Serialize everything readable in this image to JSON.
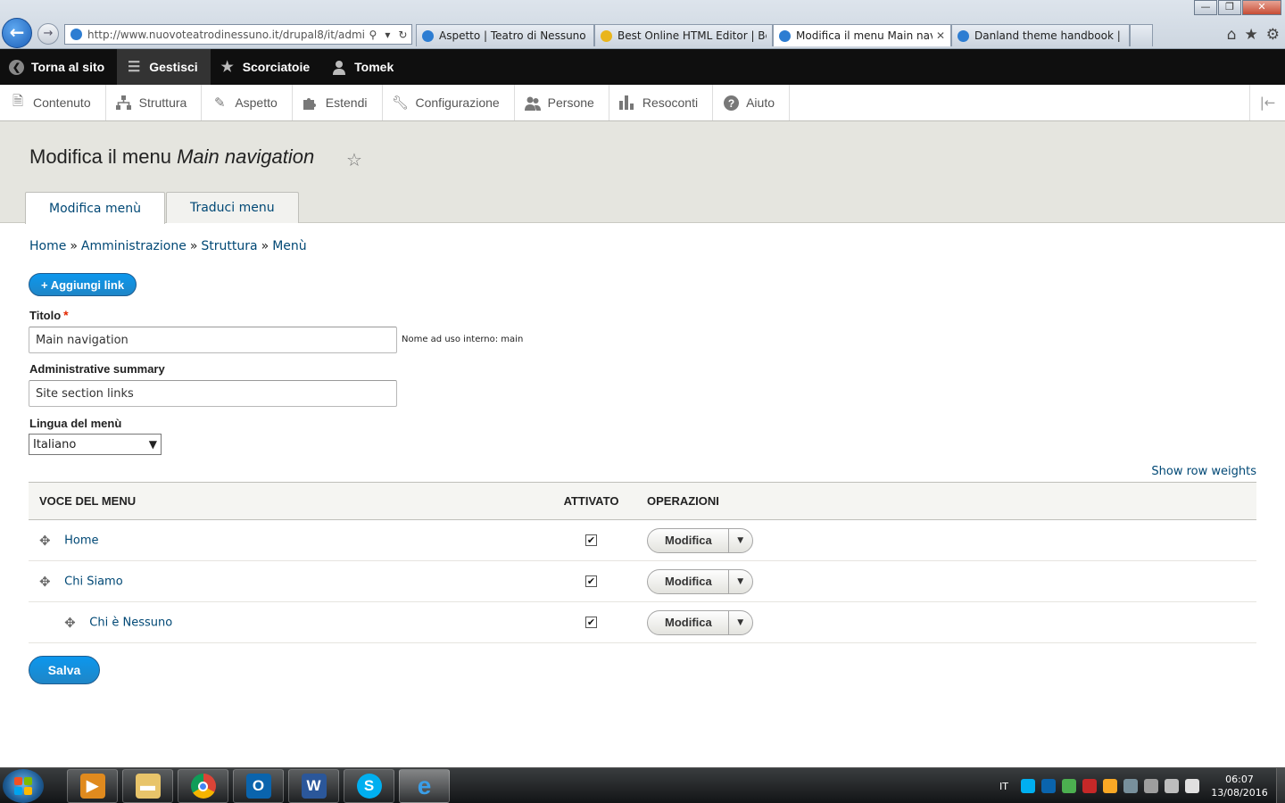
{
  "browser": {
    "url": "http://www.nuovoteatrodinessuno.it/drupal8/it/admin/str",
    "tabs": [
      {
        "label": "Aspetto | Teatro di Nessuno",
        "active": false
      },
      {
        "label": "Best Online HTML Editor | Best...",
        "active": false
      },
      {
        "label": "Modifica il menu Main navi...",
        "active": true
      },
      {
        "label": "Danland theme handbook | Dr...",
        "active": false
      }
    ],
    "controls": {
      "minimize": "—",
      "restore": "❐",
      "close": "✕"
    }
  },
  "toolbar": {
    "back": "Torna al sito",
    "manage": "Gestisci",
    "shortcuts": "Scorciatoie",
    "user": "Tomek"
  },
  "tray": {
    "items": [
      "Contenuto",
      "Struttura",
      "Aspetto",
      "Estendi",
      "Configurazione",
      "Persone",
      "Resoconti",
      "Aiuto"
    ]
  },
  "page": {
    "title_prefix": "Modifica il menu",
    "title_em": "Main navigation",
    "tabs": [
      "Modifica menù",
      "Traduci menu"
    ]
  },
  "breadcrumb": [
    "Home",
    "Amministrazione",
    "Struttura",
    "Menù"
  ],
  "add_link_button": "+ Aggiungi link",
  "form": {
    "title_label": "Titolo",
    "title_value": "Main navigation",
    "machine_name": "Nome ad uso interno: main",
    "summary_label": "Administrative summary",
    "summary_value": "Site section links",
    "language_label": "Lingua del menù",
    "language_value": "Italiano"
  },
  "show_row_weights": "Show row weights",
  "table": {
    "headers": [
      "Voce del menu",
      "Attivato",
      "Operazioni"
    ],
    "rows": [
      {
        "title": "Home",
        "enabled": true,
        "operation": "Modifica",
        "depth": 0
      },
      {
        "title": "Chi Siamo",
        "enabled": true,
        "operation": "Modifica",
        "depth": 0
      },
      {
        "title": "Chi è Nessuno",
        "enabled": true,
        "operation": "Modifica",
        "depth": 1
      }
    ]
  },
  "save_button": "Salva",
  "taskbar": {
    "language": "IT",
    "time": "06:07",
    "date": "13/08/2016"
  }
}
